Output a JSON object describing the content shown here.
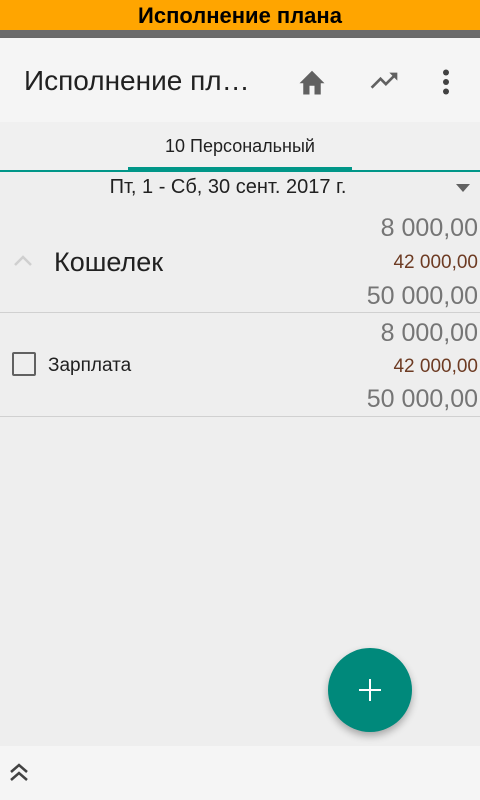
{
  "window_title": "Исполнение плана",
  "appbar": {
    "title": "Исполнение пл…",
    "home_icon": "home-icon",
    "trend_icon": "trending-up-icon",
    "menu_icon": "more-vert-icon"
  },
  "tabs": [
    {
      "label": "10 Персональный",
      "selected": true
    }
  ],
  "period": {
    "label": "Пт, 1 - Сб, 30 сент. 2017 г."
  },
  "groups": [
    {
      "name": "Кошелек",
      "expanded": true,
      "plan": "8 000,00",
      "done": "42 000,00",
      "total": "50 000,00"
    }
  ],
  "items": [
    {
      "name": "Зарплата",
      "checked": false,
      "plan": "8 000,00",
      "done": "42 000,00",
      "total": "50 000,00"
    }
  ],
  "colors": {
    "accent": "#009688",
    "fab": "#00897b",
    "title_strip": "#ffa500",
    "done_amount": "#6d3b23"
  },
  "fab": {
    "icon": "plus-icon"
  },
  "bottom_bar": {
    "icon": "double-chevron-up-icon"
  }
}
